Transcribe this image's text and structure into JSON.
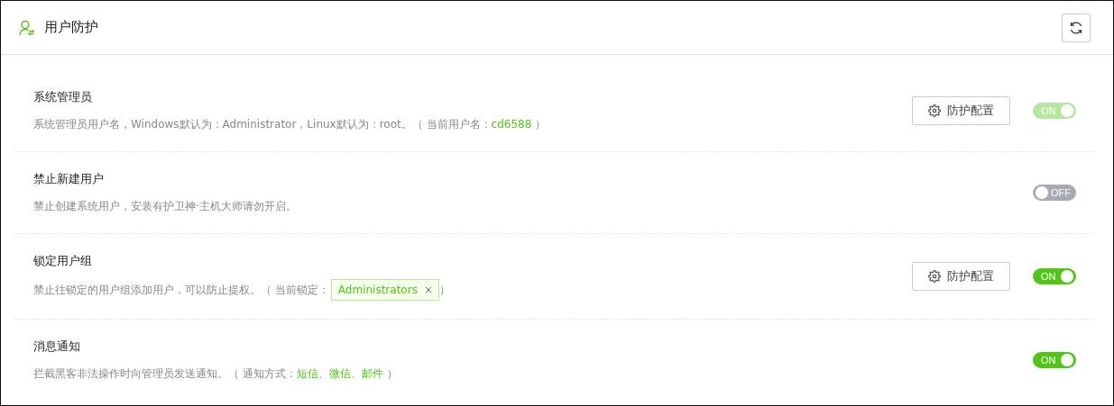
{
  "header": {
    "title": "用户防护"
  },
  "rows": [
    {
      "title": "系统管理员",
      "description": [
        {
          "kind": "text",
          "text": "系统管理员用户名，Windows默认为：Administrator，Linux默认为：root。（ 当前用户名："
        },
        {
          "kind": "highlight",
          "text": "cd6588"
        },
        {
          "kind": "text",
          "text": " ）"
        }
      ],
      "config_button": "防护配置",
      "toggle": {
        "on": true,
        "disabled": true,
        "label": "ON"
      }
    },
    {
      "title": "禁止新建用户",
      "description": [
        {
          "kind": "text",
          "text": "禁止创建系统用户，安装有护卫神·主机大师请勿开启。"
        }
      ],
      "toggle": {
        "on": false,
        "disabled": false,
        "label": "OFF"
      }
    },
    {
      "title": "锁定用户组",
      "description": [
        {
          "kind": "text",
          "text": "禁止往锁定的用户组添加用户，可以防止提权。（ 当前锁定："
        },
        {
          "kind": "tag",
          "text": "Administrators"
        },
        {
          "kind": "text",
          "text": " ）"
        }
      ],
      "config_button": "防护配置",
      "toggle": {
        "on": true,
        "disabled": false,
        "label": "ON"
      }
    },
    {
      "title": "消息通知",
      "description": [
        {
          "kind": "text",
          "text": "拦截黑客非法操作时向管理员发送通知。（ 通知方式："
        },
        {
          "kind": "highlight",
          "text": "短信、微信、邮件"
        },
        {
          "kind": "text",
          "text": " ）"
        }
      ],
      "toggle": {
        "on": true,
        "disabled": false,
        "label": "ON"
      }
    }
  ]
}
